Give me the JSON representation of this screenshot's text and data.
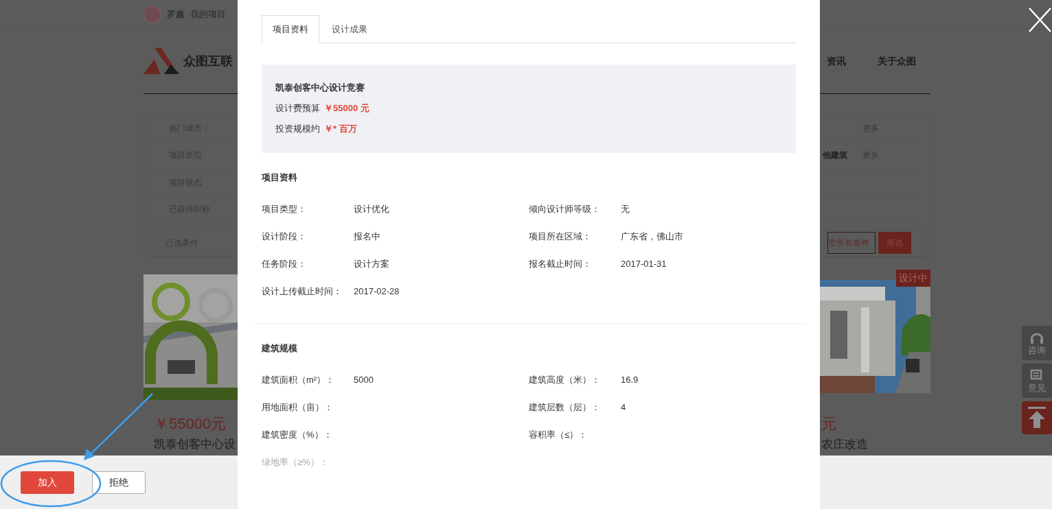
{
  "top_bar": {
    "user_name": "罗鑫",
    "link": "我的项目"
  },
  "header": {
    "logo_text": "众图互联",
    "nav": [
      "资讯",
      "关于众图"
    ]
  },
  "filters": {
    "rows": [
      {
        "label": "热门城市：",
        "more": "更多"
      },
      {
        "label": "项目类型",
        "option": "他建筑",
        "more": "更多"
      },
      {
        "label": "项目状态"
      },
      {
        "label": "已获得职称"
      }
    ],
    "selected_label": "已选条件",
    "clear_button": "空所有条件",
    "filter_button": "筛选"
  },
  "cards": [
    {
      "price": "￥55000元",
      "title": "凯泰创客中心设",
      "kind": "picture"
    },
    {
      "badge": "设计中",
      "price": "元",
      "title": "农庄改造",
      "kind": "picture"
    }
  ],
  "side_buttons": [
    {
      "kind": "consult",
      "label": "咨询"
    },
    {
      "kind": "feedback",
      "label": "意见"
    },
    {
      "kind": "top"
    }
  ],
  "modal": {
    "tabs": [
      {
        "label": "项目资料",
        "selected": true
      },
      {
        "label": "设计成果",
        "selected": false
      }
    ],
    "summary": {
      "title": "凯泰创客中心设计竞赛",
      "lines": [
        {
          "label": "设计费预算",
          "value": "￥55000 元"
        },
        {
          "label": "投资规模约",
          "value": "￥* 百万"
        }
      ]
    },
    "sections": [
      {
        "title": "项目资料",
        "fields": [
          {
            "label": "项目类型：",
            "value": "设计优化"
          },
          {
            "label": "倾向设计师等级：",
            "value": "无"
          },
          {
            "label": "设计阶段：",
            "value": "报名中"
          },
          {
            "label": "项目所在区域：",
            "value": "广东省，佛山市"
          },
          {
            "label": "任务阶段：",
            "value": "设计方案"
          },
          {
            "label": "报名截止时间：",
            "value": "2017-01-31"
          },
          {
            "label": "设计上传截止时间：",
            "value": "2017-02-28"
          }
        ]
      },
      {
        "title": "建筑规模",
        "fields": [
          {
            "label": "建筑面积（m²）：",
            "value": "5000"
          },
          {
            "label": "建筑高度（米）：",
            "value": "16.9"
          },
          {
            "label": "用地面积（亩）："
          },
          {
            "label": "建筑层数（层）：",
            "value": "4"
          },
          {
            "label": "建筑密度（%）："
          },
          {
            "label": "容积率（≤）："
          },
          {
            "label": "绿地率（≥%）：",
            "faded": true
          }
        ]
      }
    ]
  },
  "action_bar": {
    "buttons": [
      {
        "label": "加入",
        "kind": "primary"
      },
      {
        "label": "拒绝",
        "kind": "secondary"
      }
    ]
  }
}
